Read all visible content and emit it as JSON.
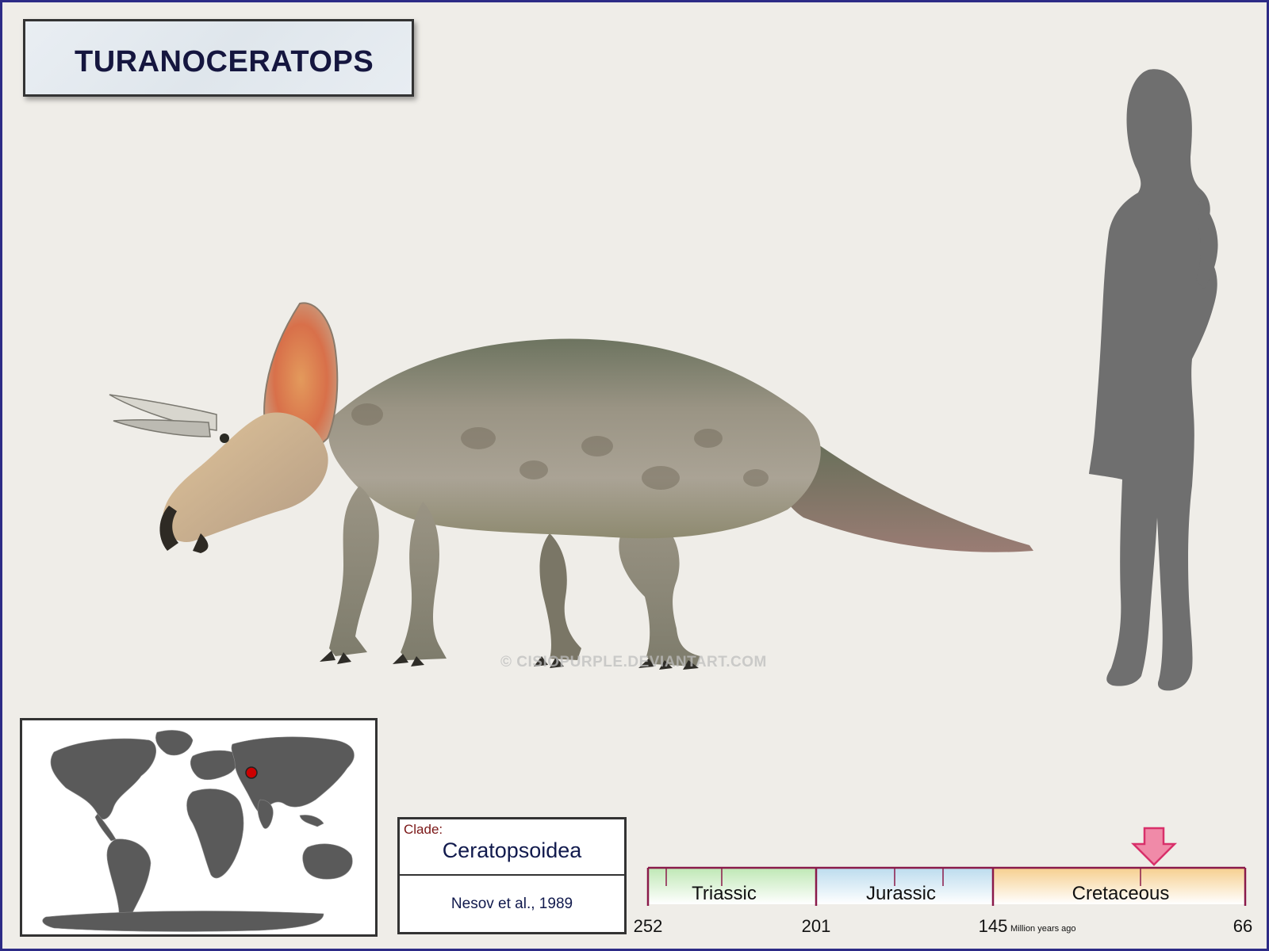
{
  "title": "TURANOCERATOPS",
  "watermark": "© CISIOPURPLE.DEVIANTART.COM",
  "clade": {
    "label": "Clade:",
    "name": "Ceratopsoidea",
    "author": "Nesov et al., 1989"
  },
  "map": {
    "location_marker_color": "#cc0000",
    "land_color": "#5a5a5a"
  },
  "timeline": {
    "periods": [
      {
        "name": "Triassic",
        "start": 252,
        "end": 201,
        "color": "#bfe8b5"
      },
      {
        "name": "Jurassic",
        "start": 201,
        "end": 145,
        "color": "#bcdcee"
      },
      {
        "name": "Cretaceous",
        "start": 145,
        "end": 66,
        "color": "#f6cf8f"
      }
    ],
    "boundary_labels": [
      "252",
      "201",
      "145",
      "66"
    ],
    "unit_label": "Million years ago",
    "arrow_color": "#f06a9a"
  },
  "images": {
    "animal": "ceratopsian-illustration",
    "scale_figure": "human-silhouette"
  }
}
